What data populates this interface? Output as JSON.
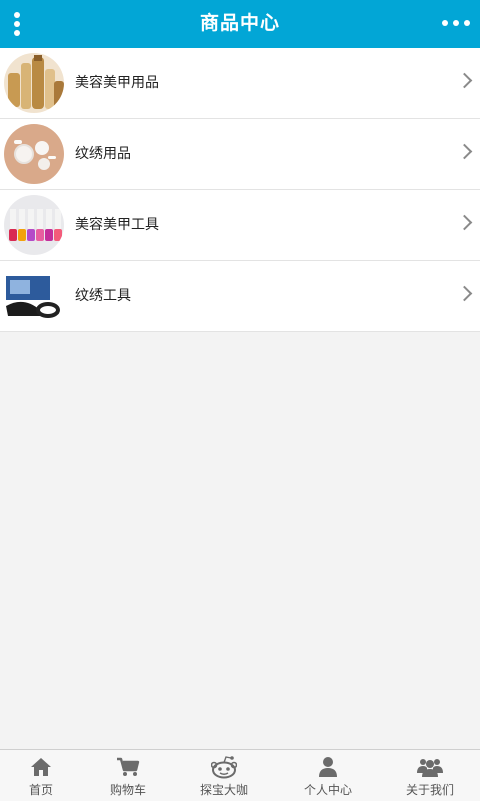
{
  "header": {
    "title": "商品中心",
    "menu_icon": "vertical-dots-icon",
    "more_icon": "horizontal-dots-icon"
  },
  "categories": [
    {
      "label": "美容美甲用品",
      "thumbnail": "cosmetic-bottles-image"
    },
    {
      "label": "纹绣用品",
      "thumbnail": "tattoo-supplies-image"
    },
    {
      "label": "美容美甲工具",
      "thumbnail": "nail-polish-bottles-image"
    },
    {
      "label": "纹绣工具",
      "thumbnail": "tattoo-machine-image"
    }
  ],
  "tabbar": {
    "items": [
      {
        "label": "首页",
        "icon": "home-icon"
      },
      {
        "label": "购物车",
        "icon": "cart-icon"
      },
      {
        "label": "探宝大咖",
        "icon": "reddit-alien-icon"
      },
      {
        "label": "个人中心",
        "icon": "user-icon"
      },
      {
        "label": "关于我们",
        "icon": "users-group-icon"
      }
    ]
  },
  "colors": {
    "header": "#02a6d6",
    "background": "#f3f3f3",
    "tab_icon": "#6b6b6b"
  }
}
